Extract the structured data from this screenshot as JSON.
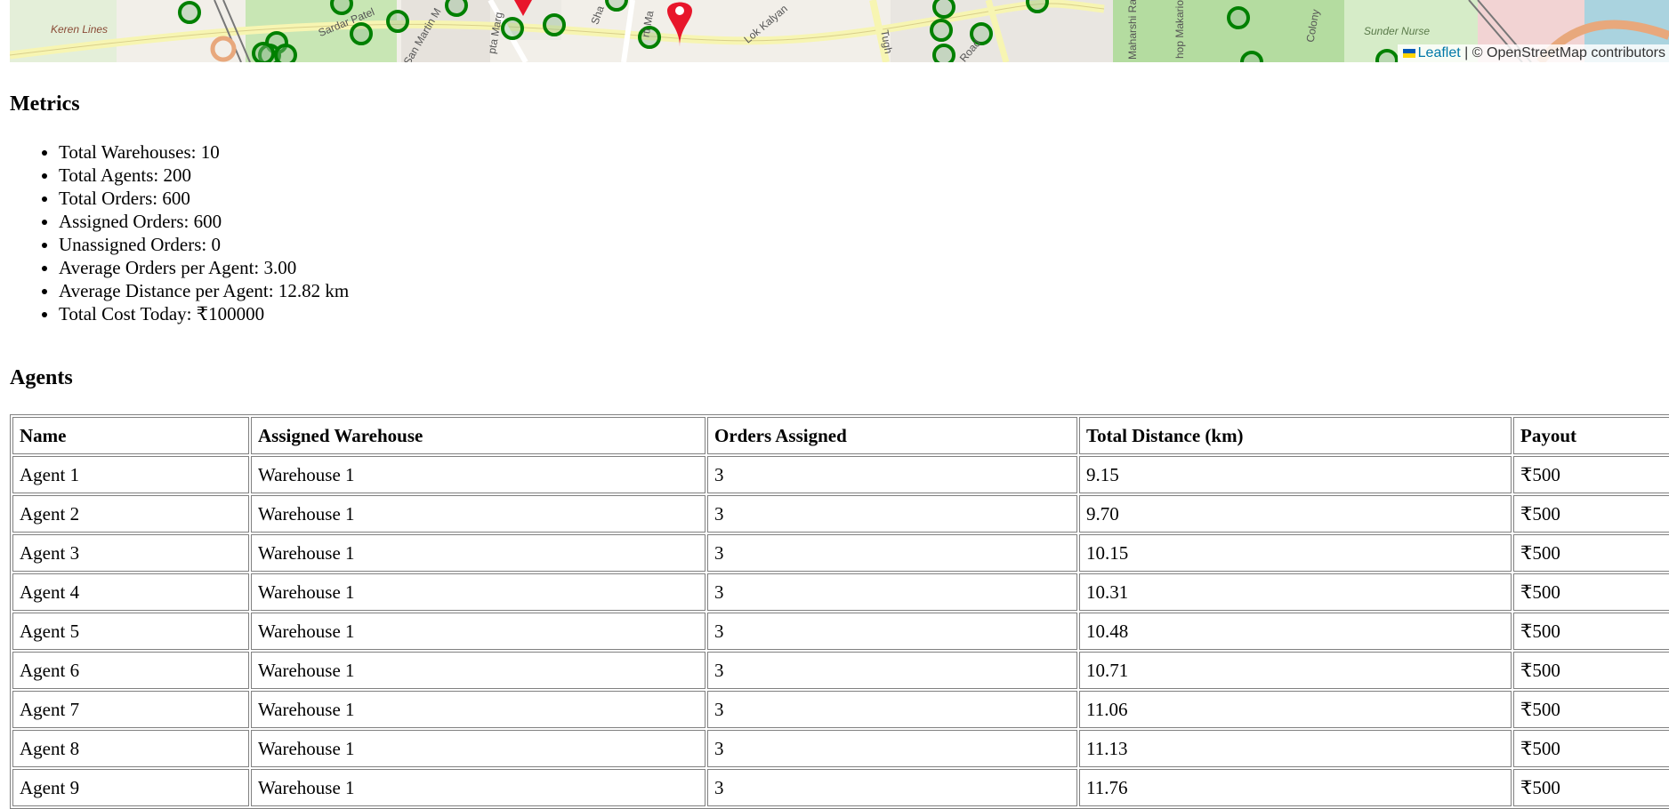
{
  "map": {
    "labels": {
      "keren_lines": "Keren Lines",
      "sardar_patel": "Sardar Patel",
      "san_martin": "San Martin M",
      "gupta_marg": "pta Marg",
      "shanti": "Sha",
      "murti_marg": "rti Ma",
      "lok_kalyan": "Lok Kalyan",
      "tughlak": "Tugh",
      "road": "Road",
      "maharshi": "Maharshi Ra",
      "bishop": "hop Makario",
      "colony": "Colony",
      "sunder_nurse": "Sunder Nurse"
    },
    "attribution": {
      "leaflet_link": "Leaflet",
      "separator": "|",
      "osm_text": "© OpenStreetMap contributors"
    },
    "colors": {
      "marker_green": "#008000",
      "marker_red": "#e8162b",
      "park_green": "#c8e6b4",
      "road_yellow": "#f7f5b2"
    }
  },
  "metrics": {
    "title": "Metrics",
    "items": [
      "Total Warehouses: 10",
      "Total Agents: 200",
      "Total Orders: 600",
      "Assigned Orders: 600",
      "Unassigned Orders: 0",
      "Average Orders per Agent: 3.00",
      "Average Distance per Agent: 12.82 km",
      "Total Cost Today: ₹100000"
    ]
  },
  "agents": {
    "title": "Agents",
    "columns": [
      "Name",
      "Assigned Warehouse",
      "Orders Assigned",
      "Total Distance (km)",
      "Payout"
    ],
    "rows": [
      [
        "Agent 1",
        "Warehouse 1",
        "3",
        "9.15",
        "₹500"
      ],
      [
        "Agent 2",
        "Warehouse 1",
        "3",
        "9.70",
        "₹500"
      ],
      [
        "Agent 3",
        "Warehouse 1",
        "3",
        "10.15",
        "₹500"
      ],
      [
        "Agent 4",
        "Warehouse 1",
        "3",
        "10.31",
        "₹500"
      ],
      [
        "Agent 5",
        "Warehouse 1",
        "3",
        "10.48",
        "₹500"
      ],
      [
        "Agent 6",
        "Warehouse 1",
        "3",
        "10.71",
        "₹500"
      ],
      [
        "Agent 7",
        "Warehouse 1",
        "3",
        "11.06",
        "₹500"
      ],
      [
        "Agent 8",
        "Warehouse 1",
        "3",
        "11.13",
        "₹500"
      ],
      [
        "Agent 9",
        "Warehouse 1",
        "3",
        "11.76",
        "₹500"
      ]
    ]
  }
}
